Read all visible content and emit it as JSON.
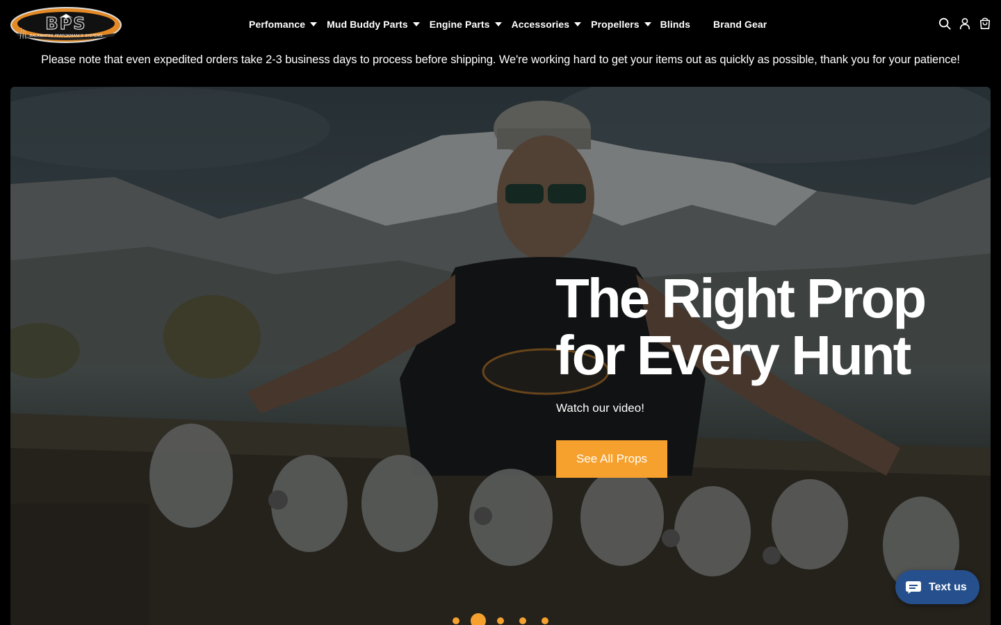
{
  "brand": {
    "logo_text": "BPS",
    "logo_subtext": "BACKWATER PERFORMANCE SYSTEMS"
  },
  "nav": {
    "items": [
      {
        "label": "Perfomance",
        "has_dropdown": true
      },
      {
        "label": "Mud Buddy Parts",
        "has_dropdown": true
      },
      {
        "label": "Engine Parts",
        "has_dropdown": true
      },
      {
        "label": "Accessories",
        "has_dropdown": true
      },
      {
        "label": "Propellers",
        "has_dropdown": true
      },
      {
        "label": "Blinds",
        "has_dropdown": false
      },
      {
        "label": "Brand Gear",
        "has_dropdown": false
      }
    ]
  },
  "header_icons": [
    "search-icon",
    "account-icon",
    "cart-icon"
  ],
  "announcement": "Please note that even expedited orders take 2-3 business days to process before shipping. We're working hard to get your items out as quickly as possible, thank you for your patience!",
  "hero": {
    "title_line1": "The Right Prop",
    "title_line2": "for Every Hunt",
    "subtitle": "Watch our video!",
    "cta_label": "See All Props",
    "slide_count": 5,
    "active_slide": 2
  },
  "chat_widget": {
    "label": "Text us",
    "icon": "chat-bubble-icon"
  },
  "colors": {
    "accent": "#f6a12e",
    "chat_bg": "#25508d",
    "header_bg": "#000000"
  }
}
